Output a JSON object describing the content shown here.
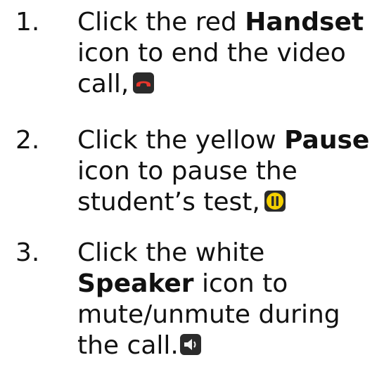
{
  "items": [
    {
      "number": "1.",
      "pre": "Click the red ",
      "bold": "Handset",
      "line2": "icon to end the video",
      "line3": "call,",
      "icon": "red-handset-icon",
      "icon_color": "#e8362c"
    },
    {
      "number": "2.",
      "pre": "Click the yellow ",
      "bold": "Pause",
      "line2": "icon to pause the",
      "line3": "student’s test,",
      "icon": "yellow-pause-icon",
      "icon_color": "#f5d000"
    },
    {
      "number": "3.",
      "line1": "Click the white",
      "bold": "Speaker",
      "line2_rest": " icon to",
      "line3": "mute/unmute during",
      "line4": "the call.",
      "icon": "white-speaker-icon",
      "icon_color": "#ffffff"
    }
  ]
}
